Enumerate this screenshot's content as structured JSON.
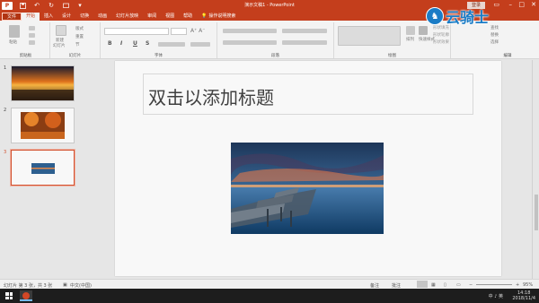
{
  "app": {
    "doc_title": "演示文稿1 - PowerPoint",
    "login_label": "登录"
  },
  "qat": {
    "logo": "P"
  },
  "tabs": [
    {
      "label": "文件"
    },
    {
      "label": "开始"
    },
    {
      "label": "插入"
    },
    {
      "label": "设计"
    },
    {
      "label": "切换"
    },
    {
      "label": "动画"
    },
    {
      "label": "幻灯片放映"
    },
    {
      "label": "审阅"
    },
    {
      "label": "视图"
    },
    {
      "label": "帮助"
    }
  ],
  "tell_me": "操作说明搜索",
  "ribbon": {
    "groups": {
      "clipboard": "剪贴板",
      "slides": "幻灯片",
      "font": "字体",
      "paragraph": "段落",
      "drawing": "绘图",
      "editing": "编辑"
    },
    "paste": "粘贴",
    "new_slide_line1": "新建",
    "new_slide_line2": "幻灯片",
    "layout": "版式",
    "reset": "重置",
    "section": "节",
    "arrange": "排列",
    "quick_styles": "快速样式",
    "shape_fill": "形状填充",
    "shape_outline": "形状轮廓",
    "shape_effects": "形状效果",
    "find": "查找",
    "replace": "替换",
    "select": "选择",
    "bold": "B",
    "italic": "I",
    "underline": "U",
    "strike": "S"
  },
  "thumbnails": [
    {
      "num": "1"
    },
    {
      "num": "2"
    },
    {
      "num": "3"
    }
  ],
  "slide": {
    "title_placeholder": "双击以添加标题"
  },
  "status": {
    "slide_info": "幻灯片 第 3 张，共 3 张",
    "language": "中文(中国)",
    "notes": "备注",
    "comments": "批注",
    "zoom": "95%"
  },
  "taskbar": {
    "time": "14:18",
    "date": "2018/11/4",
    "tray": "中 ♪ 英"
  },
  "watermark": {
    "text": "云骑士"
  },
  "colors": {
    "accent": "#c43e1c",
    "tab_active": "#f3f3f3"
  }
}
